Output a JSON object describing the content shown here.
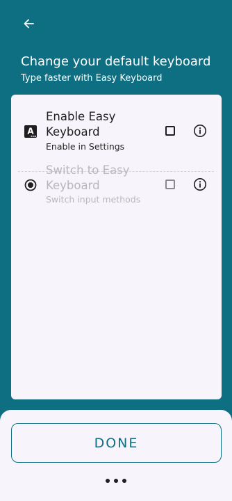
{
  "header": {
    "back_icon": "arrow-left-icon",
    "title": "Change your default keyboard",
    "subtitle": "Type faster with Easy Keyboard"
  },
  "steps": [
    {
      "icon": "keyboard-a-icon",
      "title": "Enable Easy Keyboard",
      "subtitle": "Enable in Settings",
      "checked": false,
      "enabled": true
    },
    {
      "icon": "radio-button-icon",
      "title": "Switch to Easy Keyboard",
      "subtitle": "Switch input methods",
      "checked": false,
      "enabled": false
    }
  ],
  "footer": {
    "done_label": "DONE",
    "menu_icon": "more-horizontal-icon"
  },
  "colors": {
    "primary": "#0f6f82",
    "card_bg": "#f7f4fb",
    "text": "#1f1f1f",
    "disabled_text": "#b8b8bc"
  }
}
